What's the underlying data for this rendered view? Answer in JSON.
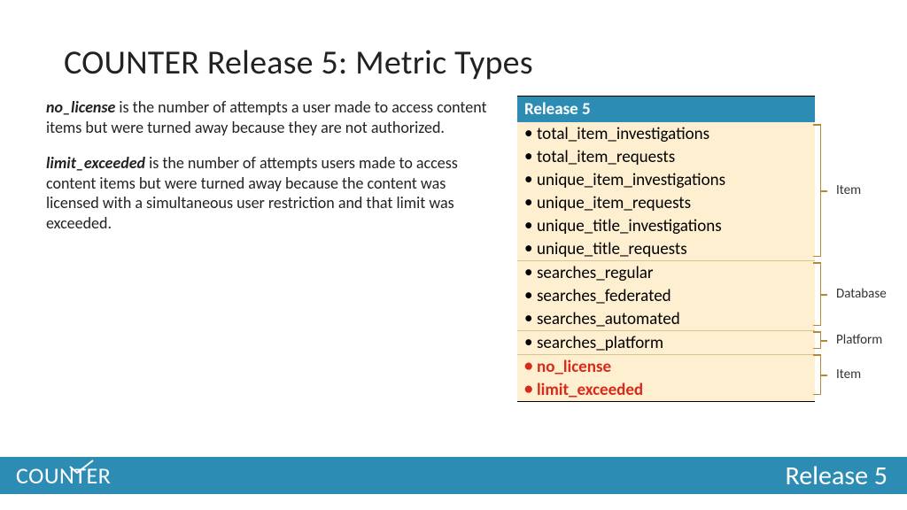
{
  "title": "COUNTER Release 5: Metric Types",
  "desc": {
    "p1_term": "no_license",
    "p1_rest": " is the number of attempts a user made to access content items but were turned away because they are not authorized.",
    "p2_term": "limit_exceeded",
    "p2_rest": " is the number of attempts users made to access content items but were turned away because the content was licensed with a simultaneous user restriction and that limit was exceeded."
  },
  "table": {
    "header": "Release 5",
    "groups": [
      {
        "label": "Item",
        "items": [
          "total_item_investigations",
          "total_item_requests",
          "unique_item_investigations",
          "unique_item_requests",
          "unique_title_investigations",
          "unique_title_requests"
        ],
        "style": "normal"
      },
      {
        "label": "Database",
        "items": [
          "searches_regular",
          "searches_federated",
          "searches_automated"
        ],
        "style": "normal"
      },
      {
        "label": "Platform",
        "items": [
          "searches_platform"
        ],
        "style": "normal"
      },
      {
        "label": "Item",
        "items": [
          "no_license",
          "limit_exceeded"
        ],
        "style": "red"
      }
    ]
  },
  "footer": {
    "logo": "COUNTER",
    "release": "Release 5"
  }
}
